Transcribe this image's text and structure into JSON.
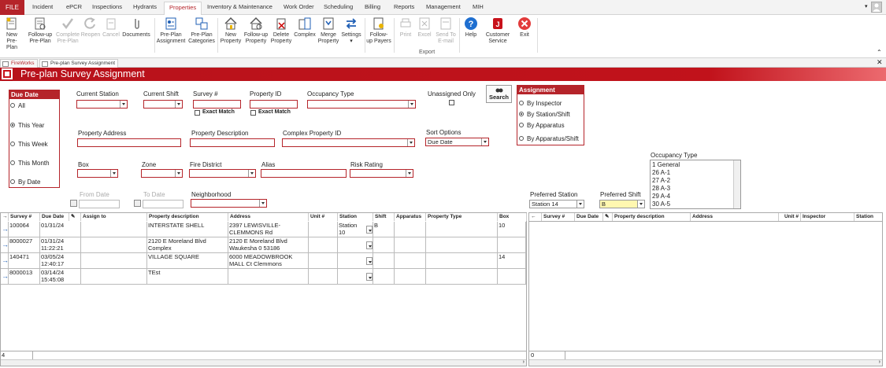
{
  "menu": {
    "file": "FILE",
    "tabs": [
      "Incident",
      "ePCR",
      "Inspections",
      "Hydrants",
      "Properties",
      "Inventory & Maintenance",
      "Work Order",
      "Scheduling",
      "Billing",
      "Reports",
      "Management",
      "MIH"
    ],
    "active": "Properties"
  },
  "ribbon": {
    "buttons": [
      {
        "l1": "New",
        "l2": "Pre-Plan",
        "icon": "new-preplan-icon",
        "enabled": true
      },
      {
        "l1": "Follow-up",
        "l2": "Pre-Plan",
        "icon": "followup-preplan-icon",
        "enabled": true
      },
      {
        "l1": "Complete",
        "l2": "Pre-Plan",
        "icon": "complete-check-icon",
        "enabled": false
      },
      {
        "l1": "Reopen",
        "l2": "",
        "icon": "reopen-icon",
        "enabled": false
      },
      {
        "l1": "Cancel",
        "l2": "",
        "icon": "cancel-icon",
        "enabled": false
      },
      {
        "l1": "Documents",
        "l2": "",
        "icon": "paperclip-icon",
        "enabled": true
      },
      {
        "l1": "Pre-Plan",
        "l2": "Assignment",
        "icon": "preplan-assignment-icon",
        "enabled": true
      },
      {
        "l1": "Pre-Plan",
        "l2": "Categories",
        "icon": "preplan-categories-icon",
        "enabled": true
      },
      {
        "l1": "New",
        "l2": "Property",
        "icon": "house-icon",
        "enabled": true
      },
      {
        "l1": "Follow-up",
        "l2": "Property",
        "icon": "followup-property-icon",
        "enabled": true
      },
      {
        "l1": "Delete",
        "l2": "Property",
        "icon": "delete-property-icon",
        "enabled": true
      },
      {
        "l1": "Complex",
        "l2": "",
        "icon": "complex-icon",
        "enabled": true
      },
      {
        "l1": "Merge",
        "l2": "Property",
        "icon": "merge-icon",
        "enabled": true
      },
      {
        "l1": "Settings",
        "l2": "",
        "icon": "settings-arrows-icon",
        "enabled": true
      },
      {
        "l1": "Follow-",
        "l2": "up Payers",
        "icon": "payers-icon",
        "enabled": true
      },
      {
        "l1": "Print",
        "l2": "",
        "icon": "print-icon",
        "enabled": false
      },
      {
        "l1": "Excel",
        "l2": "",
        "icon": "excel-icon",
        "enabled": false
      },
      {
        "l1": "Send To",
        "l2": "E-mail",
        "icon": "email-icon",
        "enabled": false
      },
      {
        "l1": "Help",
        "l2": "",
        "icon": "help-icon",
        "enabled": true
      },
      {
        "l1": "Customer",
        "l2": "Service",
        "icon": "customer-service-icon",
        "enabled": true
      },
      {
        "l1": "Exit",
        "l2": "",
        "icon": "exit-icon",
        "enabled": true
      }
    ],
    "export_label": "Export"
  },
  "doctabs": [
    "FireWorks",
    "Pre-plan Survey Assignment"
  ],
  "page_title": "Pre-plan Survey Assignment",
  "filters": {
    "due_date": {
      "title": "Due Date",
      "options": [
        "All",
        "This Year",
        "This Week",
        "This Month",
        "By Date"
      ],
      "selected": "This Year"
    },
    "current_station": {
      "label": "Current Station",
      "value": ""
    },
    "current_shift": {
      "label": "Current Shift",
      "value": ""
    },
    "survey_no": {
      "label": "Survey #",
      "value": "",
      "exact": "Exact Match"
    },
    "property_id": {
      "label": "Property ID",
      "value": "",
      "exact": "Exact Match"
    },
    "occupancy_type": {
      "label": "Occupancy Type",
      "value": ""
    },
    "unassigned_only": {
      "label": "Unassigned Only"
    },
    "search_label": "Search",
    "property_address": {
      "label": "Property Address",
      "value": ""
    },
    "property_description": {
      "label": "Property Description",
      "value": ""
    },
    "complex_property_id": {
      "label": "Complex Property ID",
      "value": ""
    },
    "sort_options": {
      "label": "Sort Options",
      "value": "Due Date"
    },
    "box": {
      "label": "Box"
    },
    "zone": {
      "label": "Zone"
    },
    "fire_district": {
      "label": "Fire District"
    },
    "alias": {
      "label": "Alias"
    },
    "risk_rating": {
      "label": "Risk Rating"
    },
    "from_date": {
      "label": "From Date"
    },
    "to_date": {
      "label": "To Date"
    },
    "neighborhood": {
      "label": "Neighborhood"
    }
  },
  "assignment": {
    "title": "Assignment",
    "options": [
      "By Inspector",
      "By Station/Shift",
      "By Apparatus",
      "By Apparatus/Shift"
    ],
    "selected": "By Station/Shift"
  },
  "occupancy_list": {
    "label": "Occupancy Type",
    "items": [
      "1 General",
      "26 A-1",
      "27 A-2",
      "28 A-3",
      "29 A-4",
      "30 A-5"
    ]
  },
  "preferred_station": {
    "label": "Preferred Station",
    "value": "Station 14"
  },
  "preferred_shift": {
    "label": "Preferred Shift",
    "value": "B"
  },
  "left_grid": {
    "headers": [
      "Survey #",
      "Due Date",
      "",
      "Assign to",
      "Property description",
      "Address",
      "Unit #",
      "Station",
      "Shift",
      "Apparatus",
      "Property Type",
      "Box"
    ],
    "rows": [
      {
        "survey": "100064",
        "date": "01/31/24",
        "time": "",
        "desc": "INTERSTATE SHELL",
        "desc2": "",
        "addr": "2397 LEWISVILLE-",
        "addr2": "CLEMMONS Rd",
        "station": "Station",
        "station2": "10",
        "shift": "B",
        "box": "10"
      },
      {
        "survey": "8000027",
        "date": "01/31/24",
        "time": "11:22:21",
        "desc": "2120 E Moreland Blvd",
        "desc2": "Complex",
        "addr": "2120 E Moreland Blvd",
        "addr2": "Waukesha 0 53186",
        "station": "",
        "station2": "",
        "shift": "",
        "box": ""
      },
      {
        "survey": "140471",
        "date": "03/05/24",
        "time": "12:40:17",
        "desc": "VILLAGE SQUARE",
        "desc2": "",
        "addr": "6000 MEADOWBROOK",
        "addr2": "MALL Ct Clemmons",
        "station": "",
        "station2": "",
        "shift": "",
        "box": "14"
      },
      {
        "survey": "8000013",
        "date": "03/14/24",
        "time": "15:45:08",
        "desc": "TEst",
        "desc2": "",
        "addr": "",
        "addr2": "",
        "station": "",
        "station2": "",
        "shift": "",
        "box": ""
      }
    ],
    "footer_count": "4"
  },
  "right_grid": {
    "headers": [
      "Survey #",
      "Due Date",
      "",
      "Property description",
      "Address",
      "Unit #",
      "Inspector",
      "Station"
    ],
    "footer_count": "0"
  }
}
